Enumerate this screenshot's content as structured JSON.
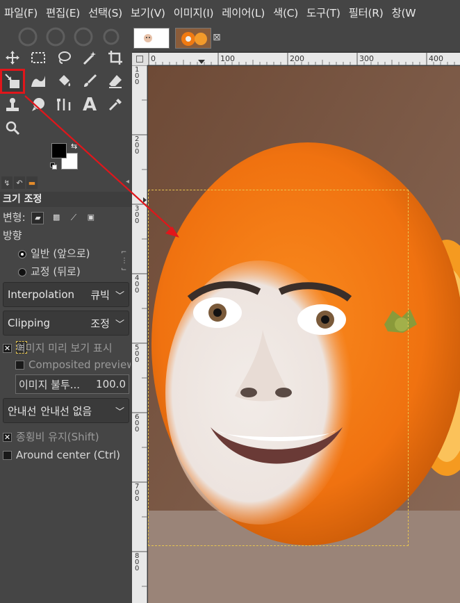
{
  "menu": [
    "파일(F)",
    "편집(E)",
    "선택(S)",
    "보기(V)",
    "이미지(I)",
    "레이어(L)",
    "색(C)",
    "도구(T)",
    "필터(R)",
    "창(W"
  ],
  "tools": [
    {
      "name": "move-tool-icon",
      "glyph": "move"
    },
    {
      "name": "rect-select-tool-icon",
      "glyph": "rect"
    },
    {
      "name": "lasso-tool-icon",
      "glyph": "lasso"
    },
    {
      "name": "fuzzy-select-tool-icon",
      "glyph": "wand"
    },
    {
      "name": "crop-tool-icon",
      "glyph": "crop"
    },
    {
      "name": "scale-tool-icon",
      "glyph": "scale"
    },
    {
      "name": "warp-tool-icon",
      "glyph": "warp"
    },
    {
      "name": "bucket-fill-tool-icon",
      "glyph": "bucket"
    },
    {
      "name": "paintbrush-tool-icon",
      "glyph": "brush"
    },
    {
      "name": "eraser-tool-icon",
      "glyph": "eraser"
    },
    {
      "name": "clone-tool-icon",
      "glyph": "clone"
    },
    {
      "name": "smudge-tool-icon",
      "glyph": "smudge"
    },
    {
      "name": "paths-tool-icon",
      "glyph": "paths"
    },
    {
      "name": "text-tool-icon",
      "glyph": "A"
    },
    {
      "name": "color-picker-tool-icon",
      "glyph": "picker"
    },
    {
      "name": "zoom-tool-icon",
      "glyph": "zoom"
    }
  ],
  "tool_options": {
    "title": "크기 조정",
    "transform_label": "변형:",
    "direction_label": "방향",
    "direction_normal": "일반 (앞으로)",
    "direction_corrective": "교정 (뒤로)",
    "interpolation_label": "Interpolation",
    "interpolation_value": "큐빅",
    "clipping_label": "Clipping",
    "clipping_value": "조정",
    "show_preview": "이미지 미리 보기 표시",
    "composited_preview": "Composited preview",
    "opacity_label": "이미지 불투...",
    "opacity_value": "100.0",
    "guides_label": "안내선",
    "guides_value": "안내선 없음",
    "keep_aspect": "종횡비 유지(Shift)",
    "around_center": "Around center (Ctrl)"
  },
  "ruler": {
    "h_ticks": [
      "0",
      "100",
      "200",
      "300",
      "400"
    ],
    "v_ticks": [
      "100",
      "200",
      "300",
      "400",
      "500",
      "600",
      "700",
      "800"
    ]
  },
  "colors": {
    "accent": "#e0161b",
    "fg": "#000000",
    "bg": "#ffffff"
  }
}
